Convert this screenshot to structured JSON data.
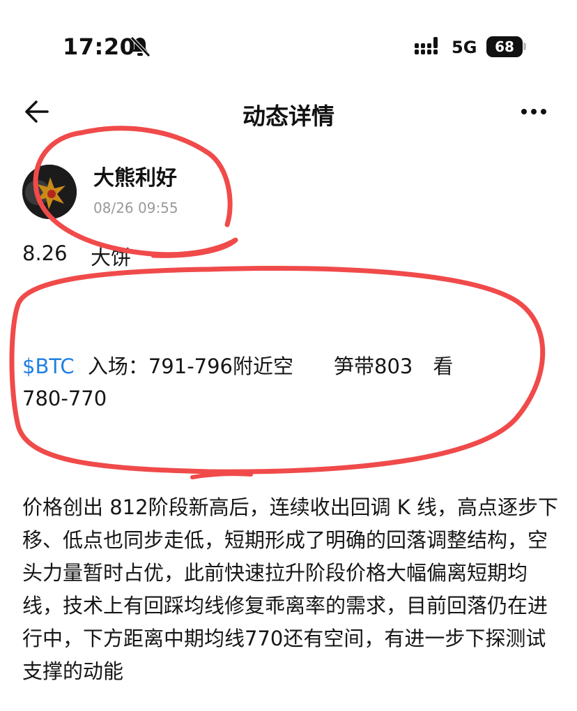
{
  "status_bar": {
    "time": "17:20",
    "network": "5G",
    "battery": "68",
    "icons": [
      "bell-off-icon",
      "signal-icon",
      "battery-icon"
    ]
  },
  "nav": {
    "title": "动态详情",
    "icons": [
      "back-arrow-icon",
      "more-icon"
    ]
  },
  "post": {
    "author": "大熊利好",
    "timestamp": "08/26 09:55",
    "title_date": "8.26",
    "title_text": "大饼",
    "ticker": "$BTC",
    "entry_line": "入场：791-796附近空　　笋带803　看",
    "entry_line2": "780-770",
    "body": "价格创出 812阶段新高后，连续收出回调 K 线，高点逐步下移、低点也同步走低，短期形成了明确的回落调整结构，空头力量暂时占优，此前快速拉升阶段价格大幅偏离短期均线，技术上有回踩均线修复乖离率的需求，目前回落仍在进行中，下方距离中期均线770还有空间，有进一步下探测试支撑的动能"
  },
  "colors": {
    "ticker": "#1f7fe6",
    "annotation": "#f04a4a",
    "timestamp": "#9a9a9a"
  }
}
